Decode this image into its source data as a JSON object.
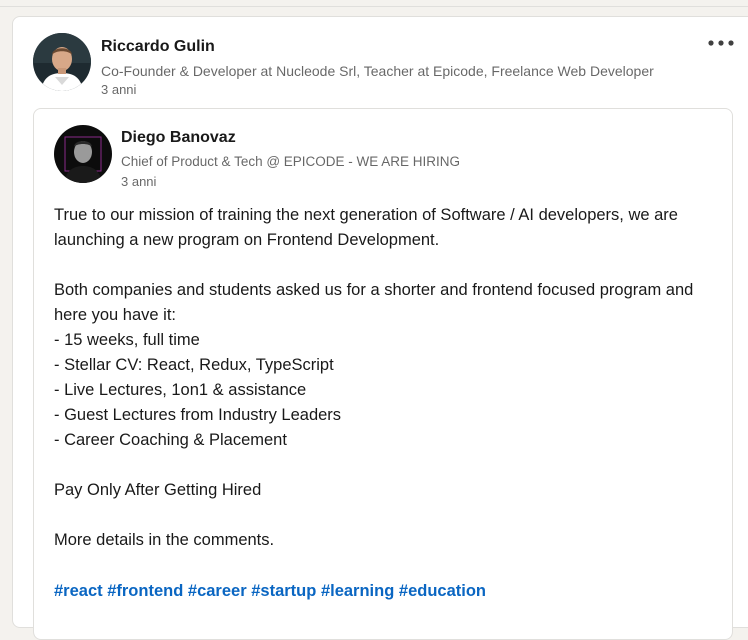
{
  "outer_post": {
    "author_name": "Riccardo Gulin",
    "author_headline": "Co-Founder & Developer at Nucleode Srl, Teacher at Epicode, Freelance Web Developer",
    "timestamp": "3 anni",
    "more_icon": "ellipsis-icon"
  },
  "shared_post": {
    "author_name": "Diego Banovaz",
    "author_headline": "Chief of Product & Tech @ EPICODE - WE ARE HIRING",
    "timestamp": "3 anni",
    "body_lines": [
      "True to our mission of training the next generation of Software / AI developers, we are",
      "launching a new program on Frontend Development.",
      "",
      "Both companies and students asked us for a shorter and frontend focused program and",
      "here you have it:",
      "- 15 weeks, full time",
      "- Stellar CV: React, Redux, TypeScript",
      "- Live Lectures, 1on1 & assistance",
      "- Guest Lectures from Industry Leaders",
      "- Career Coaching & Placement",
      "",
      "Pay Only After Getting Hired",
      "",
      "More details in the comments."
    ],
    "hashtags": [
      "#react",
      "#frontend",
      "#career",
      "#startup",
      "#learning",
      "#education"
    ]
  },
  "colors": {
    "link": "#0a66c2",
    "text_primary": "#191919",
    "text_secondary": "#666666",
    "border": "#e0dfdc"
  }
}
